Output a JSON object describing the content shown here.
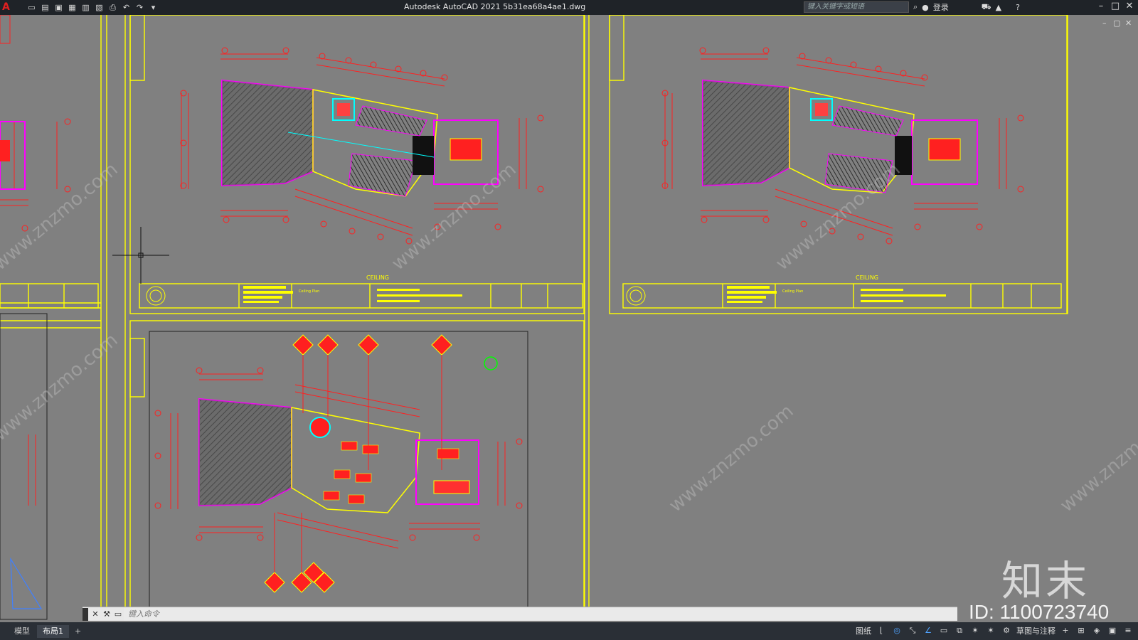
{
  "titlebar": {
    "logo": "A",
    "title": "Autodesk AutoCAD 2021    5b31ea68a4ae1.dwg",
    "search_placeholder": "键入关键字或短语",
    "login": "登录",
    "tools": [
      "new-file-icon",
      "open-file-icon",
      "save-icon",
      "save-as-icon",
      "plot-preview-icon",
      "publish-icon",
      "print-icon",
      "undo-icon",
      "redo-icon",
      "dropdown-icon"
    ]
  },
  "canvas": {
    "plan_title": "CEILING",
    "title_block_note": "Ceiling Plan"
  },
  "commandline": {
    "placeholder": "键入命令"
  },
  "statusbar": {
    "tabs": [
      {
        "label": "模型"
      },
      {
        "label": "布局1"
      }
    ],
    "paper_label": "图纸",
    "annotation_label": "草图与注释",
    "add": "+"
  },
  "watermark": {
    "brand": "知末",
    "id": "ID: 1100723740",
    "url": "www.znzmo.com"
  },
  "colors": {
    "background": "#808080",
    "titlebar": "#1f2328",
    "frame": "#ffff00",
    "walls": "#ff00ff",
    "dims": "#ff0000",
    "accent": "#00ffff"
  }
}
